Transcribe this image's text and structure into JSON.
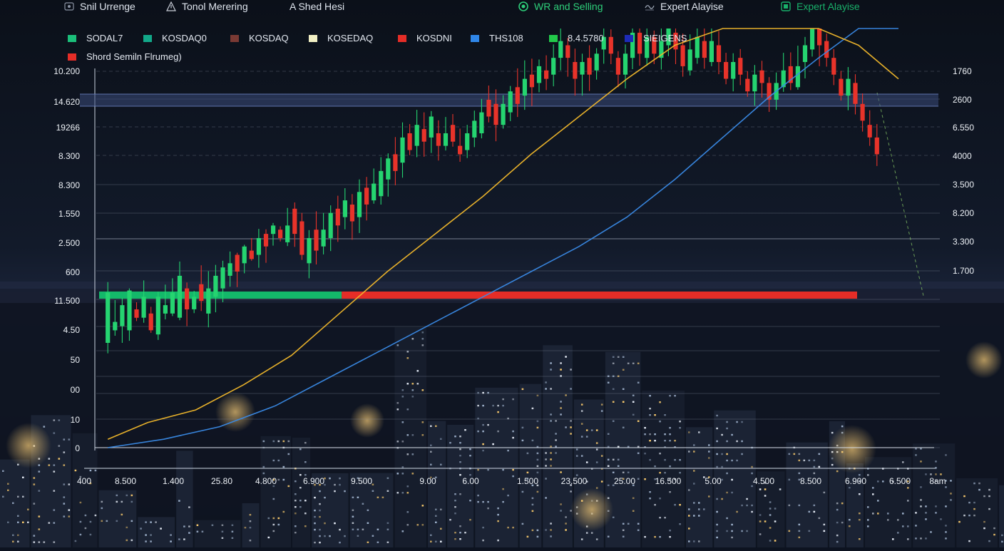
{
  "toolbar": {
    "items": [
      {
        "label": "Snil Urrenge",
        "icon": "eye-icon"
      },
      {
        "label": "Tonol Merering",
        "icon": "warning-triangle-icon"
      },
      {
        "label": "A Shed Hesi",
        "icon": ""
      },
      {
        "label": "WR and Selling",
        "icon": "target-icon",
        "color": "#2ecf7a"
      },
      {
        "label": "Expert Alayise",
        "icon": "wave-icon"
      },
      {
        "label": "Expert Alayise",
        "icon": "square-icon",
        "color": "#19b06a"
      }
    ]
  },
  "chart_data": {
    "type": "line",
    "legend": [
      {
        "name": "SODAL7",
        "color": "#1bbf7a"
      },
      {
        "name": "KOSDAQ0",
        "color": "#12a889"
      },
      {
        "name": "KOSDAQ",
        "color": "#7a3a34"
      },
      {
        "name": "KOSEDAQ",
        "color": "#f1efc4"
      },
      {
        "name": "KOSDNI",
        "color": "#e52d27"
      },
      {
        "name": "THS108",
        "color": "#2f86e8"
      },
      {
        "name": "8.4.5780",
        "color": "#22c94a"
      },
      {
        "name": "SIEIGENS",
        "color": "#1d2bb8"
      },
      {
        "name": "Shord Semiln Flrumeg)",
        "color": "#e52d27"
      }
    ],
    "y_ticks_left": [
      "10.200",
      "14.620",
      "19266",
      "8.300",
      "8.300",
      "1.550",
      "2.500",
      "600",
      "11.500",
      "4.50",
      "50",
      "00",
      "10",
      "0"
    ],
    "y_ticks_right": [
      "1760",
      "2600",
      "6.550",
      "4000",
      "3.500",
      "8.200",
      "3.300",
      "1.700"
    ],
    "x_ticks": [
      "400",
      "8.500",
      "1.400",
      "25.80",
      "4.800",
      "6.900",
      "9.500",
      "9.00",
      "6.00",
      "1.500",
      "23.500",
      "25.00",
      "16.500",
      "5.00",
      "4.500",
      "8.500",
      "6.900",
      "6.500",
      "8am"
    ],
    "grid": true,
    "x_range": [
      0,
      100
    ],
    "y_range": [
      0,
      100
    ],
    "candles": [
      [
        1.0,
        25.0,
        37.0,
        22.5,
        39.5
      ],
      [
        1.9,
        28.0,
        30.0,
        26.7,
        35.2
      ],
      [
        2.8,
        29.0,
        34.0,
        25.0,
        35.7
      ],
      [
        3.7,
        28.0,
        37.5,
        25.5,
        38.0
      ],
      [
        4.6,
        33.0,
        31.0,
        30.2,
        34.7
      ],
      [
        5.5,
        31.0,
        36.0,
        29.8,
        39.9
      ],
      [
        6.4,
        32.0,
        28.0,
        27.4,
        33.6
      ],
      [
        7.3,
        27.0,
        36.0,
        25.7,
        37.2
      ],
      [
        8.2,
        32.0,
        34.0,
        30.6,
        38.9
      ],
      [
        9.1,
        32.0,
        37.0,
        31.4,
        40.4
      ],
      [
        10.0,
        31.0,
        41.0,
        30.4,
        44.4
      ],
      [
        10.9,
        38.0,
        33.0,
        29.0,
        39.4
      ],
      [
        11.8,
        33.0,
        36.0,
        32.1,
        37.4
      ],
      [
        12.7,
        39.0,
        35.0,
        32.6,
        43.5
      ],
      [
        13.6,
        32.0,
        38.0,
        28.7,
        42.1
      ],
      [
        14.5,
        36.0,
        41.0,
        32.3,
        43.6
      ],
      [
        15.4,
        38.0,
        43.0,
        34.7,
        44.6
      ],
      [
        16.3,
        41.0,
        44.0,
        38.4,
        46.8
      ],
      [
        17.2,
        46.0,
        42.0,
        38.3,
        46.5
      ],
      [
        18.1,
        44.0,
        48.0,
        41.6,
        48.4
      ],
      [
        19.0,
        47.0,
        45.0,
        44.6,
        50.0
      ],
      [
        19.9,
        46.0,
        50.0,
        42.9,
        52.2
      ],
      [
        20.8,
        51.0,
        48.0,
        44.1,
        52.1
      ],
      [
        21.7,
        51.0,
        53.0,
        48.2,
        53.6
      ],
      [
        22.6,
        52.0,
        50.0,
        49.2,
        52.8
      ],
      [
        23.5,
        49.0,
        53.0,
        48.1,
        57.2
      ],
      [
        24.4,
        57.0,
        51.0,
        47.9,
        58.5
      ],
      [
        25.3,
        54.0,
        46.0,
        44.8,
        56.0
      ],
      [
        26.2,
        44.0,
        50.0,
        40.4,
        51.9
      ],
      [
        27.1,
        52.0,
        47.0,
        43.7,
        56.4
      ],
      [
        28.0,
        48.0,
        52.0,
        46.1,
        56.0
      ],
      [
        28.9,
        50.0,
        56.0,
        46.9,
        57.8
      ],
      [
        29.8,
        57.0,
        53.0,
        49.1,
        60.1
      ],
      [
        30.7,
        55.0,
        59.0,
        52.1,
        61.9
      ],
      [
        31.6,
        58.0,
        54.0,
        49.6,
        60.5
      ],
      [
        32.5,
        55.0,
        61.0,
        51.2,
        64.0
      ],
      [
        33.4,
        62.0,
        58.0,
        54.2,
        64.6
      ],
      [
        34.3,
        59.0,
        63.0,
        58.2,
        66.6
      ],
      [
        35.2,
        60.0,
        66.0,
        58.0,
        69.3
      ],
      [
        36.1,
        64.0,
        69.0,
        59.9,
        70.2
      ],
      [
        37.0,
        70.0,
        66.0,
        62.6,
        74.1
      ],
      [
        37.9,
        68.0,
        74.0,
        64.4,
        77.6
      ],
      [
        38.8,
        75.0,
        71.0,
        69.8,
        77.2
      ],
      [
        39.7,
        72.0,
        77.0,
        69.3,
        80.6
      ],
      [
        40.6,
        76.0,
        73.0,
        69.4,
        80.0
      ],
      [
        41.5,
        74.0,
        79.0,
        70.3,
        80.3
      ],
      [
        42.4,
        75.0,
        72.0,
        68.5,
        78.1
      ],
      [
        43.3,
        72.0,
        75.0,
        70.9,
        78.9
      ],
      [
        44.2,
        77.0,
        73.0,
        71.8,
        79.6
      ],
      [
        45.1,
        72.0,
        70.0,
        68.2,
        76.1
      ],
      [
        46.0,
        71.0,
        75.0,
        69.1,
        77.0
      ],
      [
        46.9,
        74.0,
        78.0,
        71.7,
        80.4
      ],
      [
        47.8,
        75.0,
        80.0,
        73.8,
        83.2
      ],
      [
        48.7,
        83.0,
        79.0,
        77.6,
        86.4
      ],
      [
        49.6,
        82.0,
        77.0,
        73.1,
        85.5
      ],
      [
        50.5,
        77.0,
        82.0,
        76.1,
        84.1
      ],
      [
        51.4,
        80.0,
        85.0,
        77.9,
        86.3
      ],
      [
        52.3,
        86.0,
        82.0,
        78.9,
        90.5
      ],
      [
        53.2,
        84.0,
        88.0,
        80.6,
        92.4
      ],
      [
        54.1,
        89.0,
        86.0,
        81.5,
        92.8
      ],
      [
        55.0,
        87.0,
        91.0,
        84.8,
        92.6
      ],
      [
        55.9,
        90.0,
        88.0,
        85.3,
        93.6
      ],
      [
        56.8,
        89.0,
        93.0,
        86.2,
        96.2
      ],
      [
        57.7,
        93.0,
        97.0,
        90.0,
        100.0
      ],
      [
        58.6,
        96.0,
        93.0,
        88.5,
        97.8
      ],
      [
        59.5,
        92.0,
        88.0,
        84.0,
        95.2
      ],
      [
        60.4,
        89.0,
        92.0,
        84.0,
        94.0
      ],
      [
        61.3,
        93.0,
        89.0,
        85.1,
        96.0
      ],
      [
        62.2,
        90.0,
        94.0,
        87.8,
        95.3
      ],
      [
        63.1,
        95.0,
        98.0,
        91.6,
        100.0
      ],
      [
        64.0,
        98.0,
        94.0,
        91.5,
        99.8
      ],
      [
        64.9,
        93.0,
        89.0,
        86.0,
        94.6
      ],
      [
        65.8,
        89.0,
        94.0,
        85.7,
        96.2
      ],
      [
        66.7,
        93.0,
        99.0,
        90.3,
        100.0
      ],
      [
        67.6,
        99.0,
        94.0,
        91.1,
        100.0
      ],
      [
        68.5,
        93.0,
        98.0,
        91.1,
        100.0
      ],
      [
        69.4,
        98.0,
        94.0,
        91.5,
        99.5
      ],
      [
        70.3,
        93.0,
        97.0,
        90.2,
        100.0
      ],
      [
        71.2,
        96.0,
        100.0,
        93.4,
        100.0
      ],
      [
        72.1,
        99.0,
        95.0,
        91.5,
        100.0
      ],
      [
        73.0,
        96.0,
        91.0,
        88.5,
        98.8
      ],
      [
        73.9,
        90.0,
        95.0,
        88.8,
        98.6
      ],
      [
        74.8,
        93.0,
        98.0,
        91.6,
        100.0
      ],
      [
        75.7,
        97.0,
        93.0,
        90.4,
        100.0
      ],
      [
        76.6,
        92.0,
        97.0,
        91.0,
        100.0
      ],
      [
        77.5,
        96.0,
        92.0,
        89.1,
        99.4
      ],
      [
        78.4,
        92.0,
        88.0,
        86.7,
        94.2
      ],
      [
        79.3,
        88.0,
        92.0,
        85.0,
        94.1
      ],
      [
        80.2,
        93.0,
        89.0,
        86.5,
        95.1
      ],
      [
        81.1,
        88.0,
        85.0,
        83.7,
        89.8
      ],
      [
        82.0,
        85.0,
        89.0,
        81.6,
        91.3
      ],
      [
        82.9,
        90.0,
        87.0,
        83.5,
        92.3
      ],
      [
        83.8,
        87.0,
        83.0,
        80.1,
        88.4
      ],
      [
        84.7,
        83.0,
        87.0,
        80.6,
        89.5
      ],
      [
        85.6,
        86.0,
        90.0,
        84.9,
        94.2
      ],
      [
        86.5,
        91.0,
        87.0,
        85.3,
        94.3
      ],
      [
        87.4,
        86.0,
        91.0,
        85.4,
        95.9
      ],
      [
        88.3,
        92.0,
        96.0,
        88.1,
        98.0
      ],
      [
        89.2,
        95.0,
        100.0,
        93.3,
        100.0
      ],
      [
        90.1,
        100.0,
        96.0,
        91.0,
        100.0
      ],
      [
        91.0,
        97.0,
        93.0,
        90.9,
        98.8
      ],
      [
        91.9,
        93.0,
        89.0,
        86.5,
        95.1
      ],
      [
        92.8,
        88.0,
        84.0,
        82.8,
        89.9
      ],
      [
        93.7,
        84.0,
        88.0,
        80.5,
        90.8
      ],
      [
        94.6,
        87.0,
        82.0,
        79.5,
        89.1
      ],
      [
        95.5,
        82.0,
        78.0,
        75.4,
        84.5
      ],
      [
        96.4,
        77.0,
        74.0,
        72.0,
        80.5
      ],
      [
        97.3,
        74.0,
        70.0,
        67.2,
        77.2
      ]
    ],
    "ma_yellow": [
      [
        1,
        2
      ],
      [
        6,
        6
      ],
      [
        12,
        9
      ],
      [
        18,
        15
      ],
      [
        24,
        22
      ],
      [
        30,
        32
      ],
      [
        36,
        42
      ],
      [
        42,
        51
      ],
      [
        48,
        60
      ],
      [
        54,
        70
      ],
      [
        60,
        79
      ],
      [
        66,
        88
      ],
      [
        72,
        96
      ],
      [
        78,
        100
      ],
      [
        84,
        100
      ],
      [
        90,
        100
      ],
      [
        95,
        96
      ],
      [
        100,
        88
      ]
    ],
    "ma_blue": [
      [
        1,
        0
      ],
      [
        8,
        2
      ],
      [
        15,
        5
      ],
      [
        22,
        10
      ],
      [
        29,
        17
      ],
      [
        36,
        24
      ],
      [
        42,
        30
      ],
      [
        48,
        36
      ],
      [
        54,
        42
      ],
      [
        60,
        48
      ],
      [
        66,
        55
      ],
      [
        72,
        64
      ],
      [
        78,
        74
      ],
      [
        84,
        84
      ],
      [
        90,
        93
      ],
      [
        95,
        100
      ],
      [
        100,
        100
      ]
    ],
    "threshold_bar": {
      "split": 32,
      "green": "#14b86a",
      "red": "#e52d27"
    },
    "band": {
      "color": "#3a4a7a"
    }
  }
}
